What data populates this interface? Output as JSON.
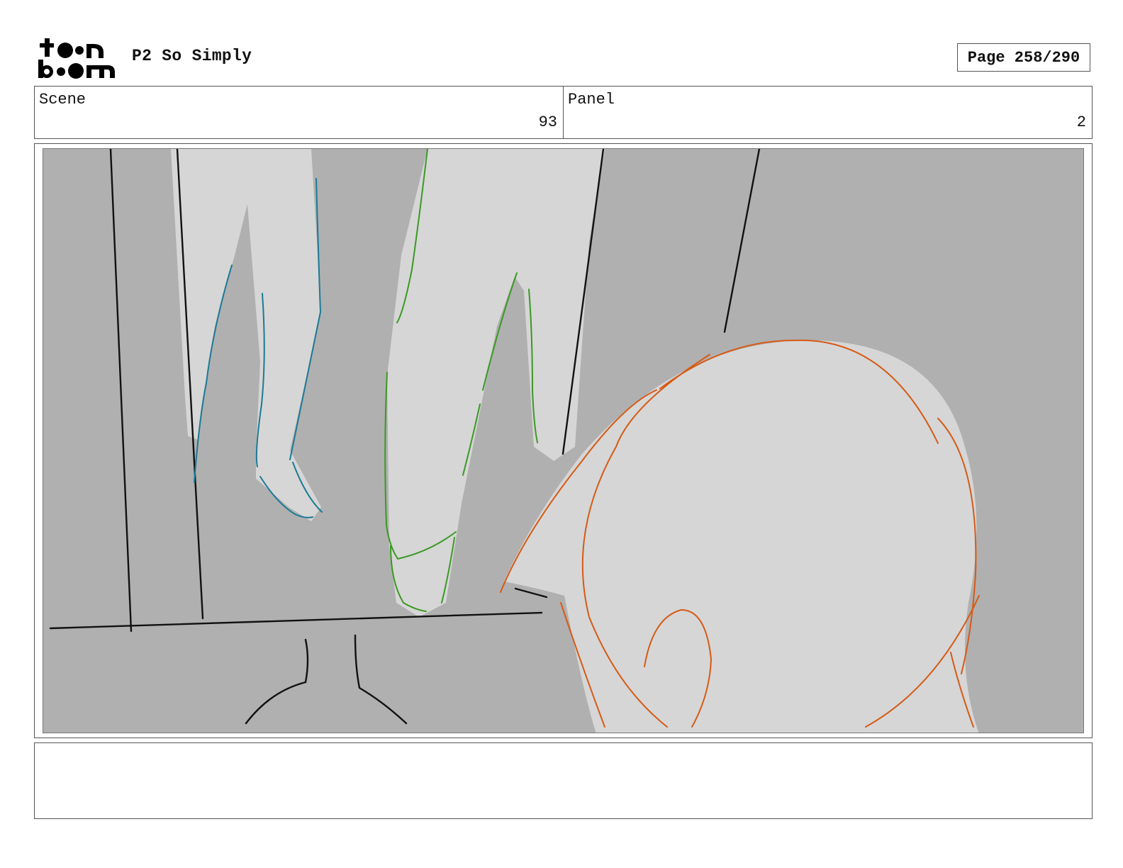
{
  "header": {
    "logo_text": "toon boom",
    "project_title": "P2 So Simply",
    "page_label": "Page 258/290"
  },
  "info": {
    "scene_label": "Scene",
    "scene_value": "93",
    "panel_label": "Panel",
    "panel_value": "2"
  },
  "panel": {
    "description": "",
    "colors": {
      "background": "#b0b0b0",
      "figure_fill": "#d6d6d6",
      "line_black": "#111111",
      "line_teal": "#1b7a96",
      "line_green": "#3a9a22",
      "line_orange": "#d65a14"
    }
  },
  "notes": {
    "text": ""
  }
}
